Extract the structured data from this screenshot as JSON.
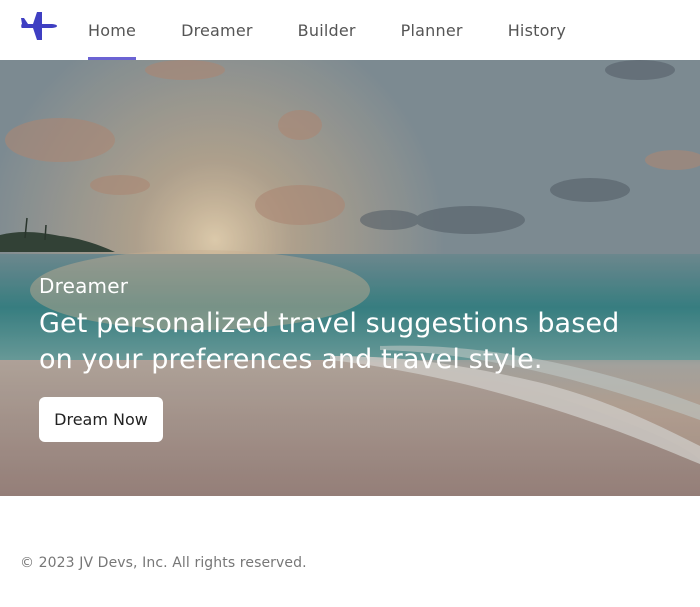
{
  "nav": {
    "logo_icon": "airplane-icon",
    "brand_color": "#3f3fc2",
    "items": [
      {
        "label": "Home",
        "active": true
      },
      {
        "label": "Dreamer",
        "active": false
      },
      {
        "label": "Builder",
        "active": false
      },
      {
        "label": "Planner",
        "active": false
      },
      {
        "label": "History",
        "active": false
      }
    ],
    "active_indicator_color": "#6b63d3"
  },
  "hero": {
    "eyebrow": "Dreamer",
    "heading": "Get personalized travel suggestions based on your preferences and travel style.",
    "cta_label": "Dream Now",
    "background_image": "beach-sunset-photo"
  },
  "footer": {
    "copyright": "© 2023 JV Devs, Inc. All rights reserved."
  }
}
